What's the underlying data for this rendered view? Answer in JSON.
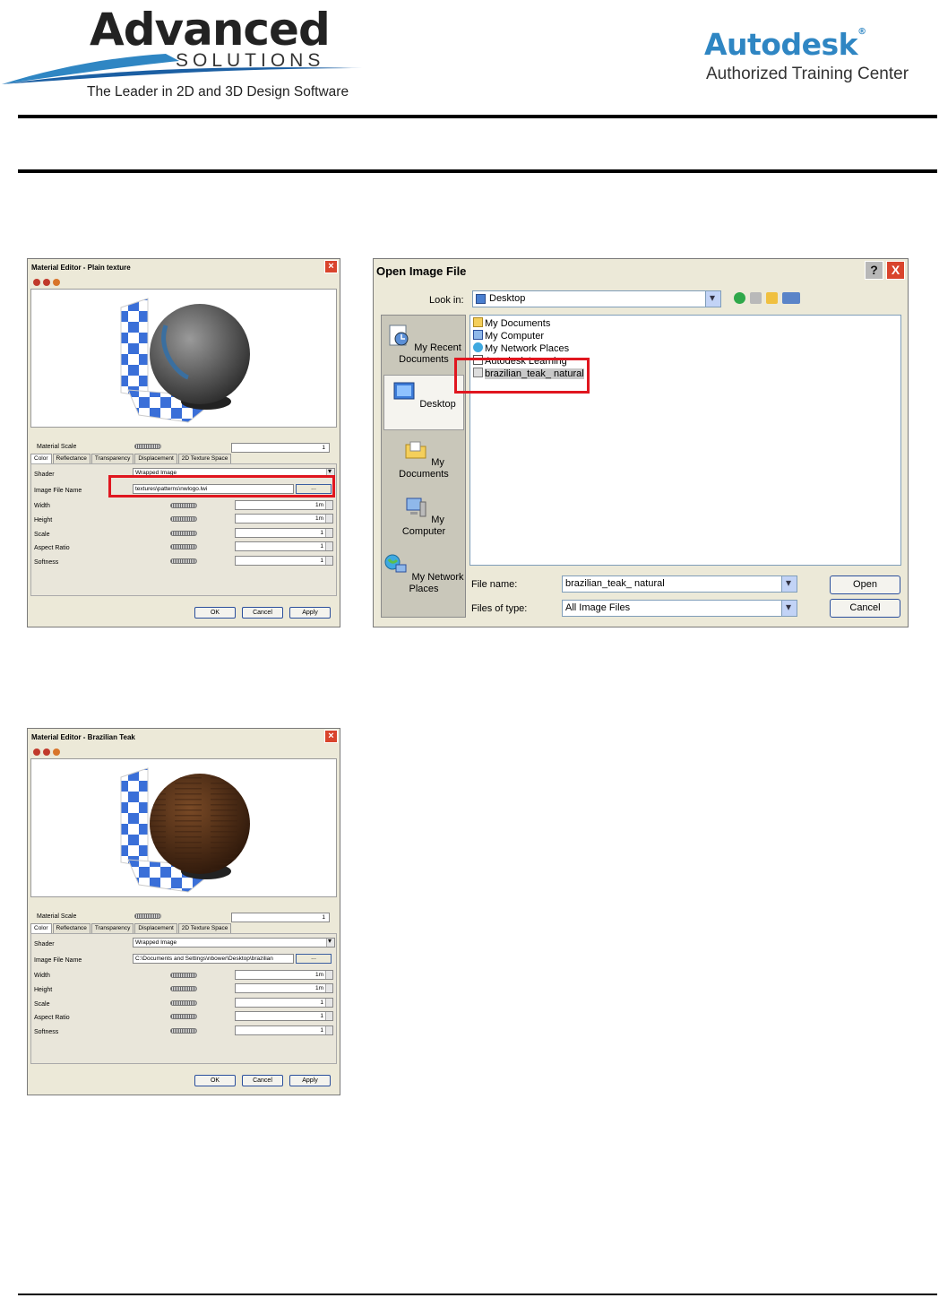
{
  "header": {
    "brand_name": "Advanced",
    "brand_sub": "SOLUTIONS",
    "brand_tagline": "The Leader in 2D and 3D Design Software",
    "partner_name": "Autodesk",
    "partner_reg": "®",
    "partner_sub": "Authorized Training Center"
  },
  "editor1": {
    "title": "Material Editor - Plain texture",
    "material_scale_label": "Material Scale",
    "material_scale_value": "1",
    "tabs": [
      "Color",
      "Reflectance",
      "Transparency",
      "Displacement",
      "2D Texture Space"
    ],
    "shader_label": "Shader",
    "shader_value": "Wrapped Image",
    "image_file_label": "Image File Name",
    "image_file_value": "textures\\patterns\\nwlogo.lwi",
    "browse_label": "...",
    "rows": [
      {
        "label": "Width",
        "value": "1m"
      },
      {
        "label": "Height",
        "value": "1m"
      },
      {
        "label": "Scale",
        "value": "1"
      },
      {
        "label": "Aspect Ratio",
        "value": "1"
      },
      {
        "label": "Softness",
        "value": "1"
      }
    ],
    "ok_label": "OK",
    "cancel_label": "Cancel",
    "apply_label": "Apply"
  },
  "editor2": {
    "title": "Material Editor - Brazilian Teak",
    "material_scale_label": "Material Scale",
    "material_scale_value": "1",
    "tabs": [
      "Color",
      "Reflectance",
      "Transparency",
      "Displacement",
      "2D Texture Space"
    ],
    "shader_label": "Shader",
    "shader_value": "Wrapped Image",
    "image_file_label": "Image File Name",
    "image_file_value": "C:\\Documents and Settings\\nbower\\Desktop\\brazilian",
    "browse_label": "...",
    "rows": [
      {
        "label": "Width",
        "value": "1m"
      },
      {
        "label": "Height",
        "value": "1m"
      },
      {
        "label": "Scale",
        "value": "1"
      },
      {
        "label": "Aspect Ratio",
        "value": "1"
      },
      {
        "label": "Softness",
        "value": "1"
      }
    ],
    "ok_label": "OK",
    "cancel_label": "Cancel",
    "apply_label": "Apply"
  },
  "open_dialog": {
    "title": "Open Image File",
    "help_label": "?",
    "close_label": "X",
    "look_in_label": "Look in:",
    "look_in_value": "Desktop",
    "places": [
      "My Recent Documents",
      "Desktop",
      "My Documents",
      "My Computer",
      "My Network Places"
    ],
    "files": [
      "My Documents",
      "My Computer",
      "My Network Places",
      "Autodesk Learning",
      "brazilian_teak_ natural"
    ],
    "file_name_label": "File name:",
    "file_name_value": "brazilian_teak_ natural",
    "files_of_type_label": "Files of type:",
    "files_of_type_value": "All Image Files",
    "open_label": "Open",
    "cancel_label": "Cancel"
  },
  "colors": {
    "highlight_red": "#e0161f",
    "checker_blue": "#3a6fd8",
    "autodesk_blue": "#2f86c3",
    "teak_brown": "#5a3218"
  }
}
